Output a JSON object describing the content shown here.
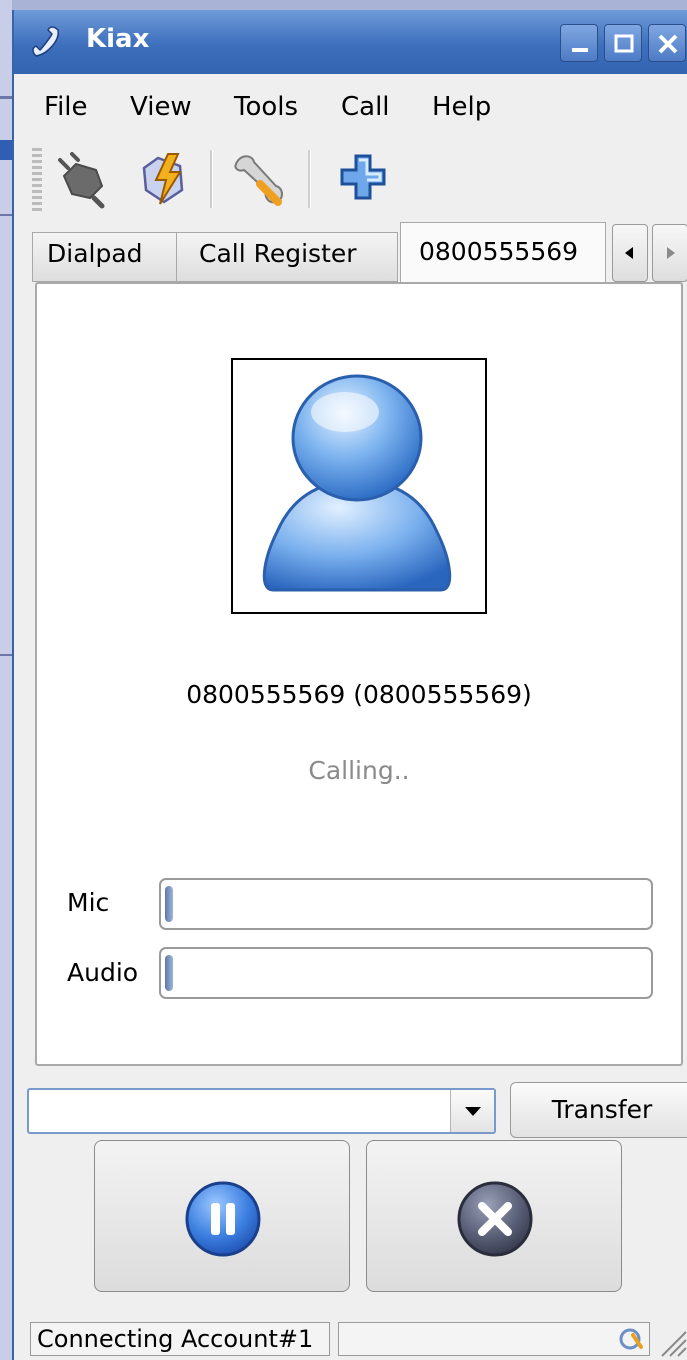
{
  "window": {
    "title": "Kiax"
  },
  "titlebar_buttons": [
    {
      "name": "minimize-button",
      "icon": "minimize-icon"
    },
    {
      "name": "maximize-button",
      "icon": "maximize-icon"
    },
    {
      "name": "close-button",
      "icon": "close-icon"
    }
  ],
  "menu": {
    "file": "File",
    "view": "View",
    "tools": "Tools",
    "call": "Call",
    "help": "Help"
  },
  "toolbar": {
    "icons": [
      "disconnect-plug-icon",
      "connect-lightning-icon",
      "settings-wrench-icon",
      "add-contact-plus-icon"
    ]
  },
  "tabs": {
    "dialpad": "Dialpad",
    "call_register": "Call Register",
    "active_call": "0800555569",
    "scroll_left": "scroll-left-icon",
    "scroll_right": "scroll-right-icon"
  },
  "call": {
    "caller": "0800555569 (0800555569)",
    "status": "Calling..",
    "avatar": "user-avatar-icon"
  },
  "meters": {
    "mic_label": "Mic",
    "mic_level": 0.0,
    "audio_label": "Audio",
    "audio_level": 0.0
  },
  "transfer": {
    "input_value": "",
    "button_label": "Transfer"
  },
  "actions": {
    "hold": "pause-icon",
    "hangup": "hangup-x-icon"
  },
  "status": {
    "text": "Connecting Account#1",
    "secondary": "",
    "indicator": "connecting-indicator-icon"
  },
  "colors": {
    "titlebar": "#3d6fbd",
    "accent_blue": "#3b7ad6",
    "hangup_gray": "#5a5f78"
  }
}
